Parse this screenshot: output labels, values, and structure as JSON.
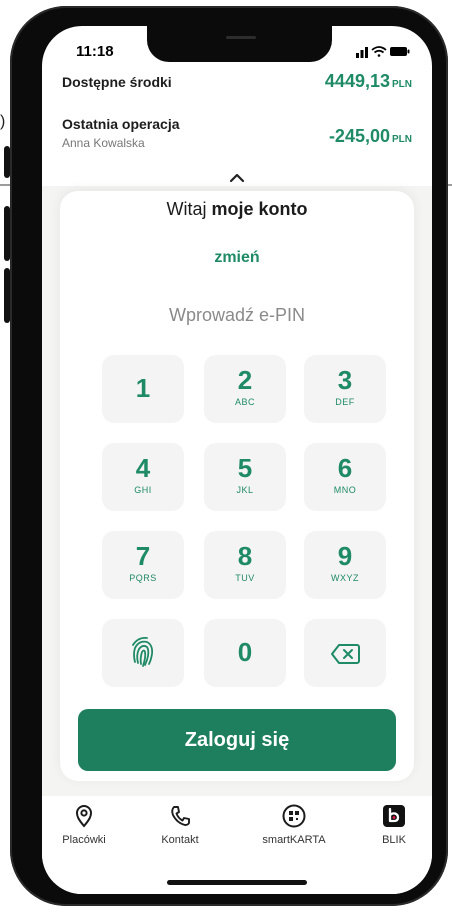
{
  "status_bar": {
    "time": "11:18"
  },
  "account": {
    "available_label": "Dostępne środki",
    "available_amount": "4449,13",
    "available_currency": "PLN",
    "last_op_label": "Ostatnia operacja",
    "last_op_name": "Anna Kowalska",
    "last_op_amount": "-245,00",
    "last_op_currency": "PLN"
  },
  "login": {
    "welcome_prefix": "Witaj",
    "welcome_name": "moje konto",
    "change_link": "zmień",
    "pin_placeholder": "Wprowadź e-PIN",
    "submit": "Zaloguj się"
  },
  "keypad": [
    {
      "num": "1",
      "letters": ""
    },
    {
      "num": "2",
      "letters": "ABC"
    },
    {
      "num": "3",
      "letters": "DEF"
    },
    {
      "num": "4",
      "letters": "GHI"
    },
    {
      "num": "5",
      "letters": "JKL"
    },
    {
      "num": "6",
      "letters": "MNO"
    },
    {
      "num": "7",
      "letters": "PQRS"
    },
    {
      "num": "8",
      "letters": "TUV"
    },
    {
      "num": "9",
      "letters": "WXYZ"
    },
    {
      "num": "0",
      "letters": ""
    }
  ],
  "tabs": [
    {
      "label": "Placówki",
      "icon": "location-pin-icon"
    },
    {
      "label": "Kontakt",
      "icon": "phone-icon"
    },
    {
      "label": "smartKARTA",
      "icon": "qr-card-icon"
    },
    {
      "label": "BLIK",
      "icon": "blik-icon"
    }
  ],
  "outside": {
    "edge_text": ")"
  },
  "colors": {
    "accent": "#1f8a66",
    "button": "#1d7f5e",
    "key_bg": "#f3f4f3"
  }
}
